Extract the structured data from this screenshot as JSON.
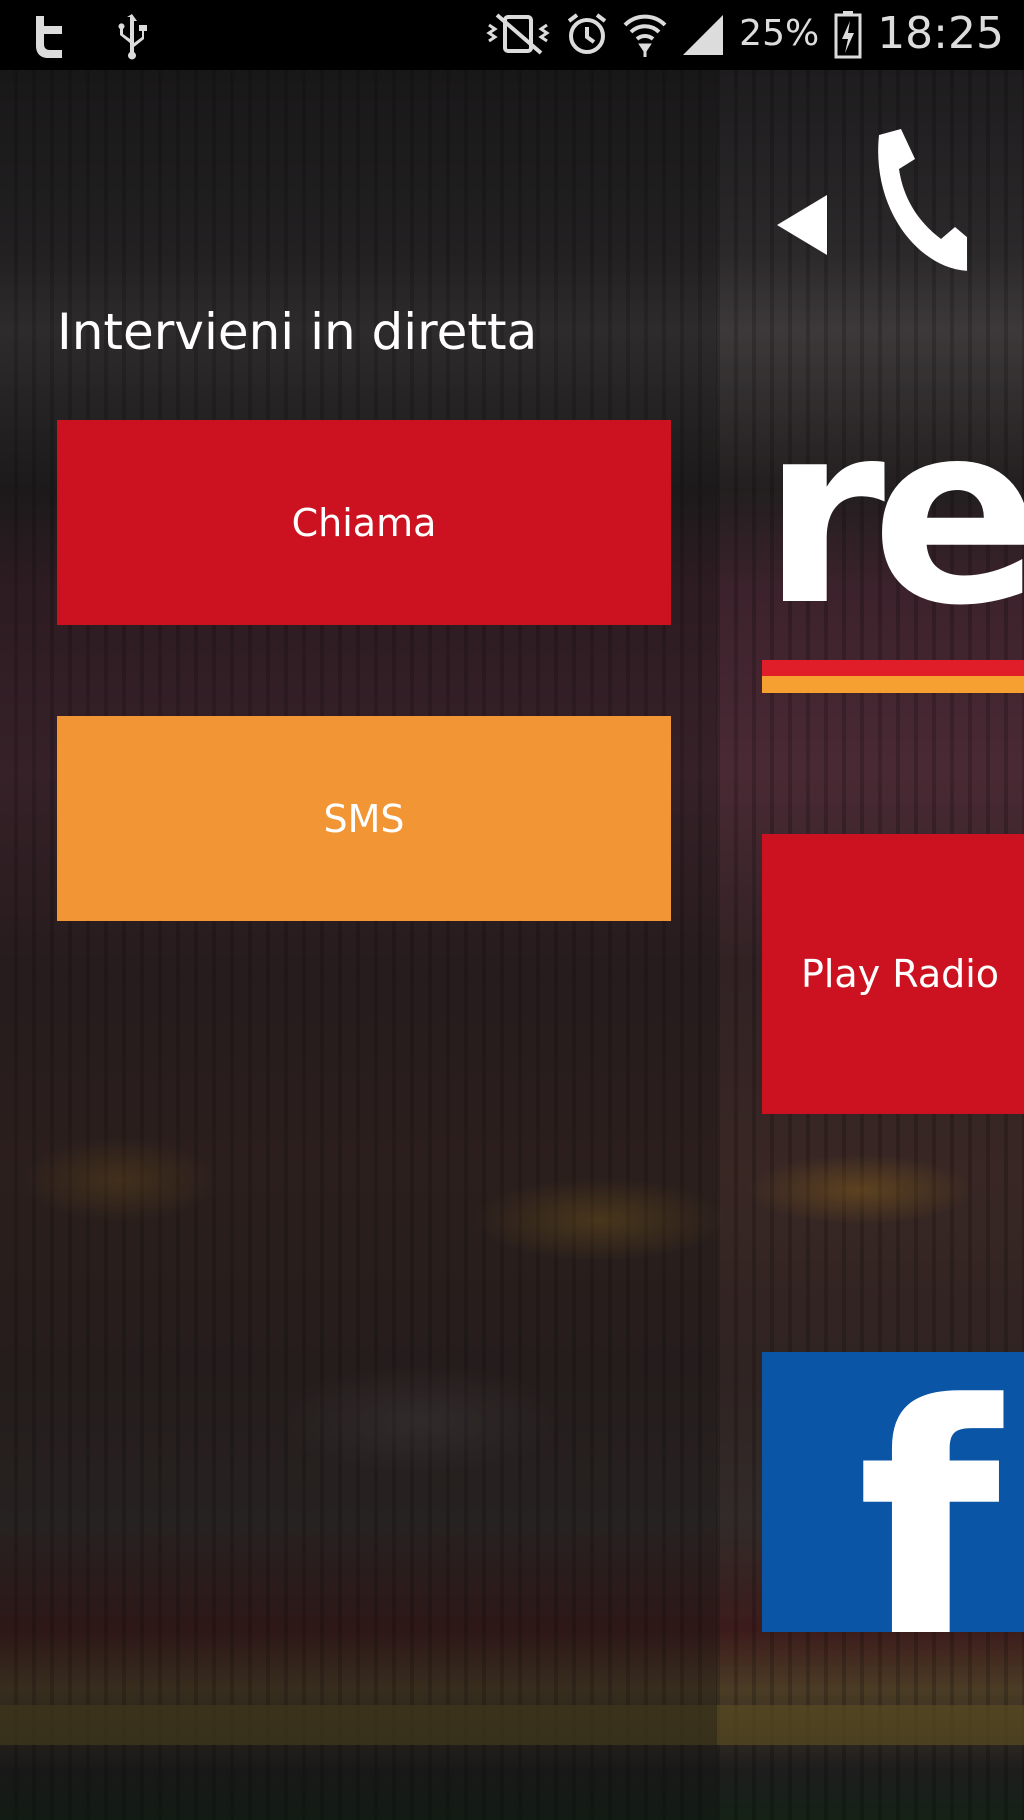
{
  "status_bar": {
    "left_icons": [
      "twitter-icon",
      "usb-icon"
    ],
    "right_icons": [
      "vibrate-mute-icon",
      "alarm-icon",
      "wifi-icon",
      "signal-icon",
      "battery-charging-icon"
    ],
    "battery_percent": "25%",
    "time": "18:25"
  },
  "drawer": {
    "title": "Intervieni in diretta",
    "call_label": "Chiama",
    "sms_label": "SMS"
  },
  "main": {
    "header_icon": "call-back-icon",
    "logo_partial": "ret",
    "play_radio_label": "Play Radio",
    "facebook_icon": "facebook-icon",
    "facebook_glyph": "f"
  },
  "colors": {
    "accent_red": "#cc1220",
    "accent_orange": "#f29535",
    "facebook_blue": "#0b55a6"
  }
}
